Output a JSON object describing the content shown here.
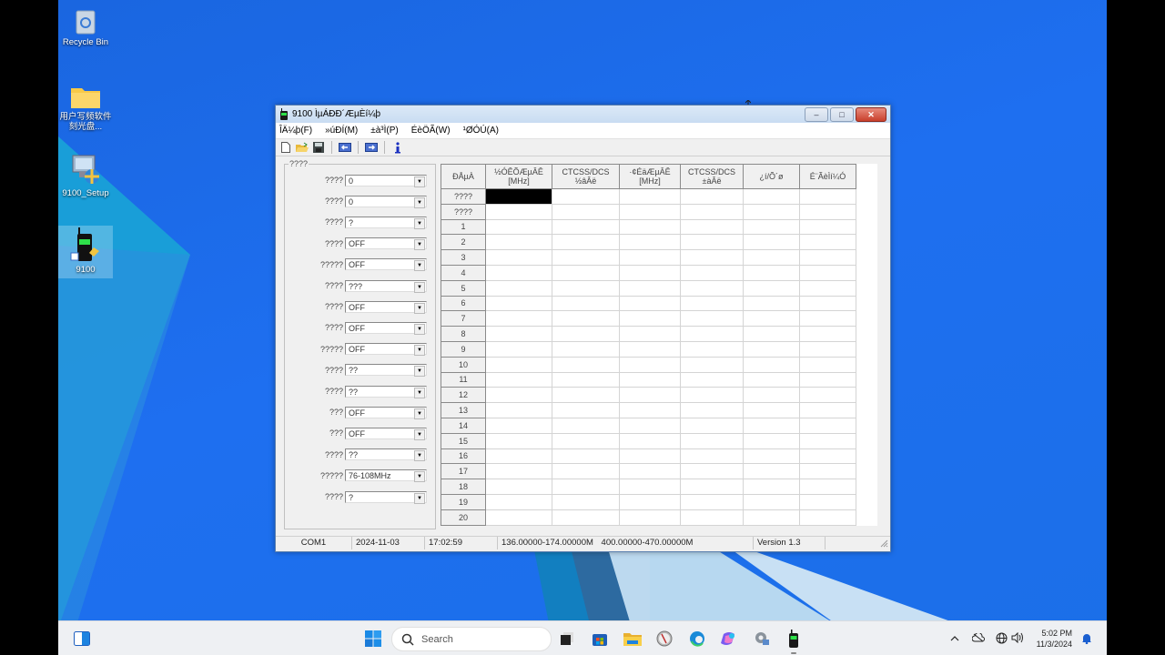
{
  "desktop": {
    "icons": [
      {
        "label": "Recycle Bin",
        "icon": "recycle-bin-icon"
      },
      {
        "label": "用户写频软件刻光盘...",
        "icon": "folder-icon"
      },
      {
        "label": "9100_Setup",
        "icon": "setup-installer-icon"
      },
      {
        "label": "9100",
        "icon": "radio-shortcut-icon"
      }
    ]
  },
  "window": {
    "title": "9100 ÌµÁÐÐ´ÆµÈí¼þ",
    "controls": {
      "minimize": "–",
      "maximize": "□",
      "close": "✕"
    },
    "menu": [
      "ÎÄ¼þ(F)",
      "»úÐÍ(M)",
      "±à³Ì(P)",
      "ÉèÖÃ(W)",
      "¹ØÓÚ(A)"
    ],
    "toolbar": [
      {
        "name": "new-file",
        "icon": "new-document-icon"
      },
      {
        "name": "open-file",
        "icon": "open-folder-icon"
      },
      {
        "name": "save-file",
        "icon": "save-disk-icon"
      },
      {
        "name": "read-from-radio",
        "icon": "read-arrow-icon"
      },
      {
        "name": "write-to-radio",
        "icon": "write-arrow-icon"
      },
      {
        "name": "about",
        "icon": "info-icon"
      }
    ],
    "settings_group": {
      "legend": "????",
      "rows": [
        {
          "label": "????",
          "value": "0"
        },
        {
          "label": "????",
          "value": "0"
        },
        {
          "label": "????",
          "value": "?"
        },
        {
          "label": "????",
          "value": "OFF"
        },
        {
          "label": "?????",
          "value": "OFF"
        },
        {
          "label": "????",
          "value": "???"
        },
        {
          "label": "????",
          "value": "OFF"
        },
        {
          "label": "????",
          "value": "OFF"
        },
        {
          "label": "?????",
          "value": "OFF"
        },
        {
          "label": "????",
          "value": "??"
        },
        {
          "label": "????",
          "value": "??"
        },
        {
          "label": "???",
          "value": "OFF"
        },
        {
          "label": "???",
          "value": "OFF"
        },
        {
          "label": "????",
          "value": "??"
        },
        {
          "label": "?????",
          "value": "76-108MHz"
        },
        {
          "label": "????",
          "value": "?"
        }
      ]
    },
    "grid": {
      "headers": [
        "ÐÅµÀ",
        "½ÓÊÕÆµÂÊ\n[MHz]",
        "CTCSS/DCS\n½âÂë",
        "·¢ÉäÆµÂÊ\n[MHz]",
        "CTCSS/DCS\n±àÂë",
        "¿í/Õ­´ø",
        "É¨ÃèÌí¼Ó"
      ],
      "row_labels": [
        "????",
        "????",
        "1",
        "2",
        "3",
        "4",
        "5",
        "6",
        "7",
        "8",
        "9",
        "10",
        "11",
        "12",
        "13",
        "14",
        "15",
        "16",
        "17",
        "18",
        "19",
        "20"
      ],
      "selected_cell": {
        "row": 0,
        "col": 1
      }
    },
    "statusbar": {
      "port": "COM1",
      "date": "2024-11-03",
      "time": "17:02:59",
      "vhf_range": "136.00000-174.00000M",
      "uhf_range": "400.00000-470.00000M",
      "version": "Version 1.3",
      "extra": ""
    }
  },
  "taskbar": {
    "search_placeholder": "Search",
    "pinned": [
      "task-view-icon",
      "microsoft-store-icon",
      "file-explorer-icon",
      "clock-app-icon",
      "edge-icon",
      "copilot-icon",
      "settings-icon",
      "radio-app-icon"
    ],
    "tray": {
      "time": "5:02 PM",
      "date": "11/3/2024"
    }
  }
}
